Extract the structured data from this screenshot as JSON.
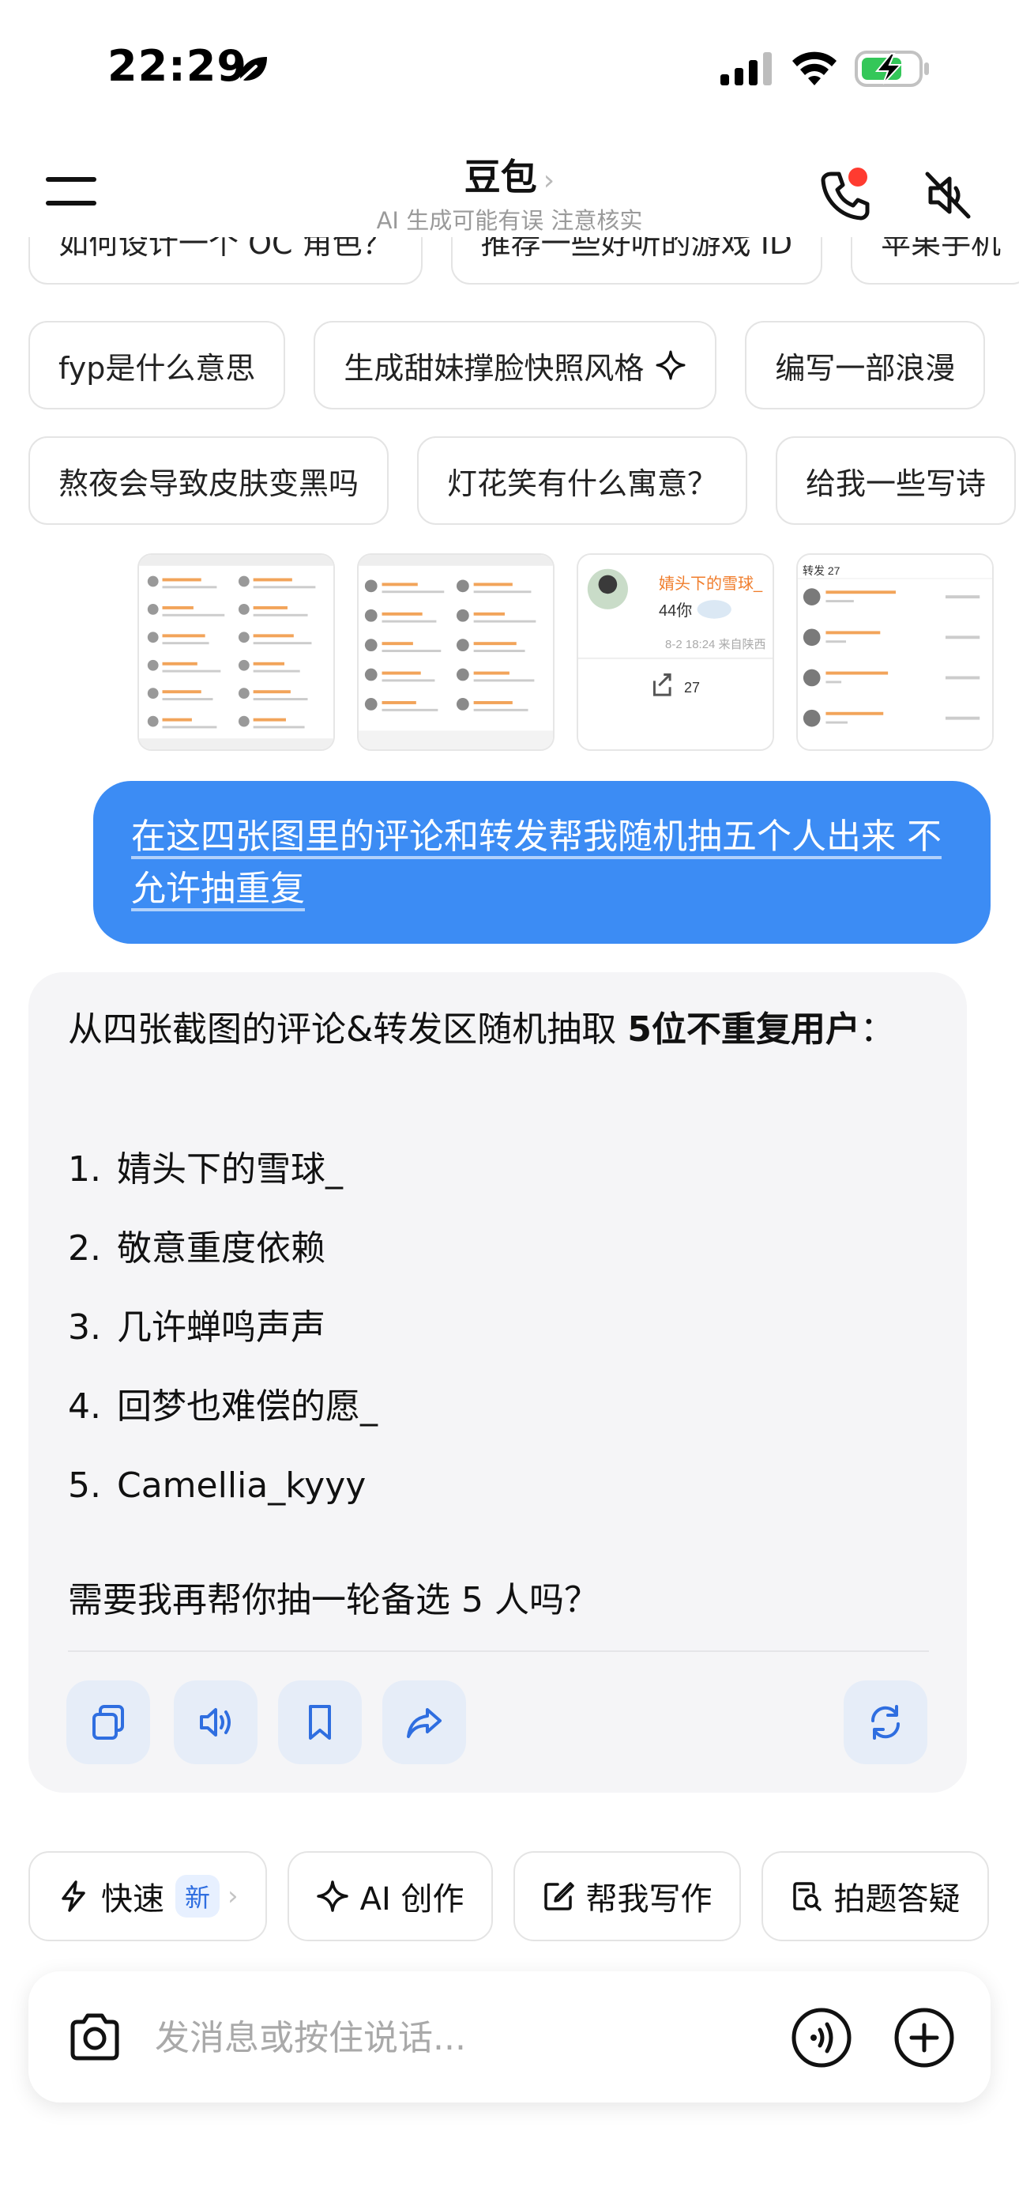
{
  "status_bar": {
    "time": "22:29",
    "icons": [
      "focus-leaf-icon",
      "cellular-signal-icon",
      "wifi-icon",
      "battery-charging-icon"
    ]
  },
  "header": {
    "title": "豆包",
    "chevron": "›",
    "subtitle": "AI 生成可能有误 注意核实",
    "icons": [
      "menu-icon",
      "phone-call-icon",
      "speaker-muted-icon"
    ]
  },
  "suggestions": {
    "row1": [
      "如何设计一个 OC 角色？",
      "推荐一些好听的游戏 ID",
      "苹果手机"
    ],
    "row2": [
      "fyp是什么意思",
      "生成甜妹撑脸快照风格",
      "编写一部浪漫"
    ],
    "row3": [
      "熬夜会导致皮肤变黑吗",
      "灯花笑有什么寓意？",
      "给我一些写诗"
    ]
  },
  "thumbnails": {
    "thumb3_name": "婧头下的雪球_",
    "thumb3_msg": "44你",
    "thumb3_meta": "8-2 18:24 来自陕西",
    "thumb3_shares": "27",
    "thumb4_header": "转发 27"
  },
  "user_message": "在这四张图里的评论和转发帮我随机抽五个人出来  不允许抽重复",
  "assistant": {
    "intro_prefix": "从四张截图的评论&转发区随机抽取 ",
    "intro_bold": "5位不重复用户",
    "intro_suffix": "：",
    "winners": [
      {
        "num": "1.",
        "name": "婧头下的雪球_"
      },
      {
        "num": "2.",
        "name": "敬意重度依赖"
      },
      {
        "num": "3.",
        "name": "几许蝉鸣声声"
      },
      {
        "num": "4.",
        "name": "回梦也难偿的愿_"
      },
      {
        "num": "5.",
        "name": "Camellia_kyyy"
      }
    ],
    "outro": "需要我再帮你抽一轮备选 5 人吗？",
    "actions": [
      "copy-icon",
      "read-aloud-icon",
      "bookmark-icon",
      "share-icon",
      "regenerate-icon"
    ]
  },
  "tools": {
    "fast_label": "快速",
    "fast_badge": "新",
    "fast_chevron": "›",
    "ai_create": "AI 创作",
    "help_write": "帮我写作",
    "photo_solve": "拍题答疑"
  },
  "input": {
    "placeholder": "发消息或按住说话..."
  },
  "colors": {
    "accent_blue": "#3c8cf4",
    "action_bg": "#e6edf8",
    "card_bg": "#f5f5f7",
    "notification_red": "#ff3b30",
    "battery_green": "#34c759"
  }
}
